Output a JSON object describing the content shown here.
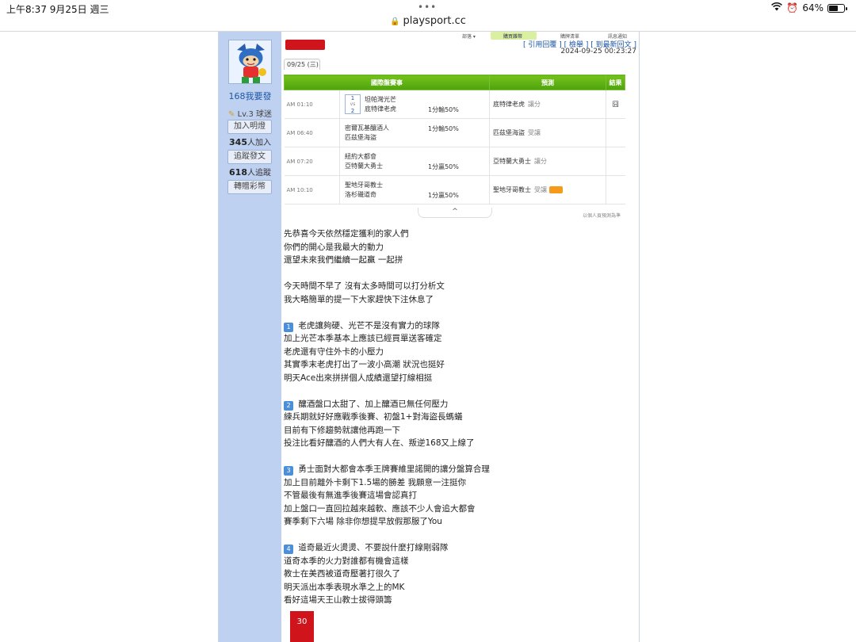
{
  "status_bar": {
    "time_date": "上午8:37   9月25日 週三",
    "battery": "64%",
    "battery_level": 0.64
  },
  "browser": {
    "url": "playsport.cc"
  },
  "toolbar": {
    "item1": "部落 ▾",
    "item2": "購買雜幣",
    "item3": "購牌清單",
    "item4": "訊息通知"
  },
  "post": {
    "links": "[ 引用回覆 ] [ 檢舉 ] [ 到最新回文 ]",
    "datetime": "2024-09-25 00:23:27",
    "date_tab": "09/25 (三)"
  },
  "sidebar": {
    "username": "168我要發",
    "level": "Lv.3 球迷",
    "btn_follow": "加入明燈",
    "follow_count": "345",
    "follow_suffix": "人加入",
    "btn_track": "追蹤發文",
    "track_count": "618",
    "track_suffix": "人追蹤",
    "btn_gift": "轉贈彩幣"
  },
  "table": {
    "headers": [
      "國際盤賽事",
      "預測",
      "結果"
    ],
    "rows": [
      {
        "time": "AM 01:10",
        "vs_top": "1",
        "vs_mid": "vs",
        "vs_bottom": "2",
        "team1": "坦帕灣光芒",
        "team2": "底特律老虎",
        "odds": "1分輸50%",
        "odds_line": 2,
        "pick": "底特律老虎",
        "type": "讓分",
        "result": "囧"
      },
      {
        "time": "AM 06:40",
        "team1": "密爾瓦基釀酒人",
        "team2": "匹茲堡海盜",
        "odds": "1分輸50%",
        "odds_line": 1,
        "pick": "匹茲堡海盜",
        "type": "受讓",
        "result": ""
      },
      {
        "time": "AM 07:20",
        "team1": "紐約大都會",
        "team2": "亞特蘭大勇士",
        "odds": "1分贏50%",
        "odds_line": 2,
        "pick": "亞特蘭大勇士",
        "type": "讓分",
        "result": ""
      },
      {
        "time": "AM 10:10",
        "team1": "聖地牙哥教士",
        "team2": "洛杉磯道奇",
        "odds": "1分贏50%",
        "odds_line": 2,
        "pick": "聖地牙哥教士",
        "type": "受讓",
        "result": ""
      }
    ],
    "collapse": "^",
    "note": "以個人頁預測為準"
  },
  "article": {
    "p1": [
      "先恭喜今天依然穩定獲利的家人們",
      "你們的開心是我最大的動力",
      "還望未來我們繼續一起贏 一起拼"
    ],
    "p2": [
      "今天時間不早了 沒有太多時間可以打分析文",
      "我大略簡單的提一下大家趕快下注休息了"
    ],
    "s1_num": "1",
    "s1": [
      "老虎讓夠硬、光芒不是沒有實力的球隊",
      "加上光芒本季基本上應該已經買單送客確定",
      "老虎還有守住外卡的小壓力",
      "其實季末老虎打出了一波小高潮 狀況也挺好",
      "明天Ace出來拼拼個人成績還望打線相挺"
    ],
    "s2_num": "2",
    "s2": [
      "釀酒盤口太甜了、加上釀酒已無任何壓力",
      "練兵期就好好應戰季後賽、初盤1+對海盜長螞蟻",
      "目前有下修趨勢就讓他再跑一下",
      "投注比看好釀酒的人們大有人在、叛逆168又上線了"
    ],
    "s3_num": "3",
    "s3": [
      "勇士面對大都會本季王牌賽維里諾開的讓分盤算合理",
      "加上目前離外卡剩下1.5場的勝差 我願意一注挺你",
      "不管最後有無進季後賽這場會認真打",
      "加上盤口一直回拉越來越軟、應該不少人會追大都會",
      "賽季剩下六場 除非你想提早放假那服了You"
    ],
    "s4_num": "4",
    "s4": [
      "道奇最近火燙燙、不要說什麼打線剛弱隊",
      "道奇本季的火力對誰都有機會這樣",
      "教士在美西被道奇壓著打很久了",
      "明天派出本季表現水準之上的MK",
      "看好這場天王山教士拔得頭籌"
    ]
  },
  "badge": {
    "text": "30"
  }
}
